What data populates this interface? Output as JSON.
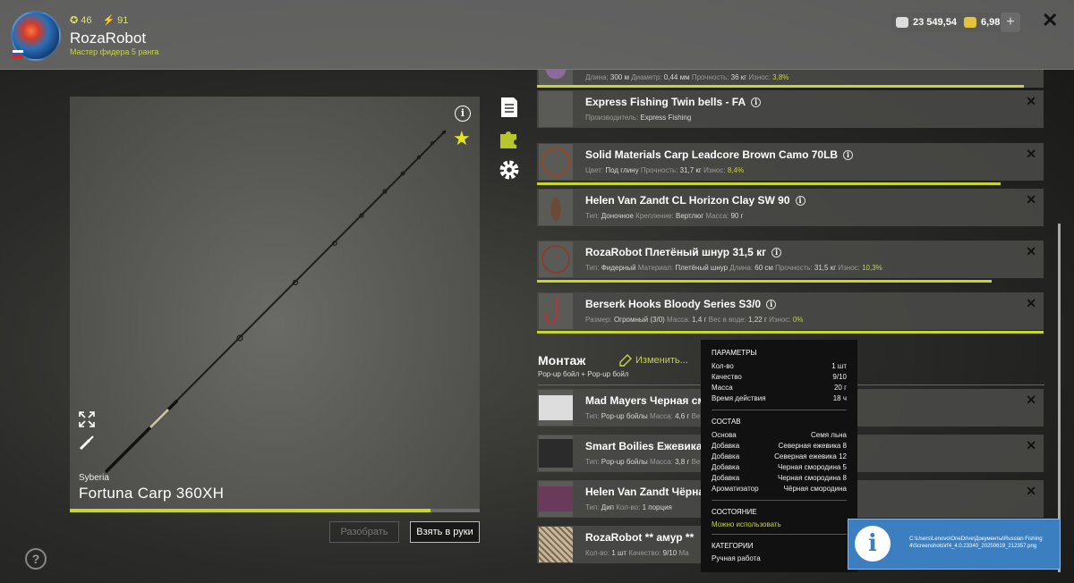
{
  "player": {
    "level": "46",
    "rating": "91",
    "name": "RozaRobot",
    "rank": "Мастер фидера 5 ранга"
  },
  "currency": {
    "silver": "23 549,54",
    "gold": "6,98",
    "add_label": "+"
  },
  "rod": {
    "brand": "Syberia",
    "name": "Fortuna Carp 360XH",
    "wear_fraction": 0.88,
    "disassemble_label": "Разобрать",
    "take_label": "Взять в руки"
  },
  "tackle": [
    {
      "name": "",
      "props": [
        {
          "k": "Длина:",
          "v": "300 м"
        },
        {
          "k": "Диаметр:",
          "v": "0,44 мм"
        },
        {
          "k": "Прочность:",
          "v": "36 кг"
        },
        {
          "k": "Износ:",
          "v": "3,8%",
          "wear": true
        }
      ]
    },
    {
      "name": "Express Fishing Twin bells - FA",
      "props": [
        {
          "k": "Производитель:",
          "v": "Express Fishing"
        }
      ]
    },
    {
      "name": "Solid Materials Carp Leadcore Brown Camo 70LB",
      "props": [
        {
          "k": "Цвет:",
          "v": "Под глину"
        },
        {
          "k": "Прочность:",
          "v": "31,7 кг"
        },
        {
          "k": "Износ:",
          "v": "8,4%",
          "wear": true
        }
      ]
    },
    {
      "name": "Helen Van Zandt CL Horizon Clay SW 90",
      "props": [
        {
          "k": "Тип:",
          "v": "Доночное"
        },
        {
          "k": "Крепление:",
          "v": "Вертлюг"
        },
        {
          "k": "Масса:",
          "v": "90 г"
        }
      ]
    },
    {
      "name": "RozaRobot Плетёный шнур 31,5 кг",
      "props": [
        {
          "k": "Тип:",
          "v": "Фидерный"
        },
        {
          "k": "Материал:",
          "v": "Плетёный шнур"
        },
        {
          "k": "Длина:",
          "v": "60 см"
        },
        {
          "k": "Прочность:",
          "v": "31,5 кг"
        },
        {
          "k": "Износ:",
          "v": "10,3%",
          "wear": true
        }
      ]
    },
    {
      "name": "Berserk Hooks Bloody Series S3/0",
      "props": [
        {
          "k": "Размер:",
          "v": "Огромный (3/0)"
        },
        {
          "k": "Масса:",
          "v": "1,4 г"
        },
        {
          "k": "Вес в воде:",
          "v": "1,22 г"
        },
        {
          "k": "Износ:",
          "v": "0%",
          "wear": true
        }
      ]
    }
  ],
  "montage": {
    "title": "Монтаж",
    "edit_label": "Изменить...",
    "subtitle": "Pop-up бойл  +  Pop-up бойл",
    "items": [
      {
        "name": "Mad Mayers Черная смо",
        "props": [
          {
            "k": "Тип:",
            "v": "Pop-up бойлы"
          },
          {
            "k": "Масса:",
            "v": "4,6 г"
          },
          {
            "k": "Ве",
            "v": ""
          }
        ]
      },
      {
        "name": "Smart Boilies Ежевика Р",
        "props": [
          {
            "k": "Тип:",
            "v": "Pop-up бойлы"
          },
          {
            "k": "Масса:",
            "v": "3,8 г"
          },
          {
            "k": "Ве",
            "v": ""
          }
        ]
      },
      {
        "name": "Helen Van Zandt Чёрная",
        "props": [
          {
            "k": "Тип:",
            "v": "Дип"
          },
          {
            "k": "Кол-во:",
            "v": "1 порция"
          }
        ]
      },
      {
        "name": "RozaRobot ** амур **",
        "props": [
          {
            "k": "Кол-во:",
            "v": "1 шт"
          },
          {
            "k": "Качество:",
            "v": "9/10"
          },
          {
            "k": "Ма",
            "v": ""
          }
        ]
      }
    ]
  },
  "tooltip": {
    "params_title": "ПАРАМЕТРЫ",
    "params": [
      {
        "k": "Кол-во",
        "v": "1 шт"
      },
      {
        "k": "Качество",
        "v": "9/10"
      },
      {
        "k": "Масса",
        "v": "20 г"
      },
      {
        "k": "Время действия",
        "v": "18 ч"
      }
    ],
    "composition_title": "СОСТАВ",
    "composition": [
      {
        "k": "Основа",
        "v": "Семя льна"
      },
      {
        "k": "Добавка",
        "v": "Северная ежевика 8"
      },
      {
        "k": "Добавка",
        "v": "Северная ежевика 12"
      },
      {
        "k": "Добавка",
        "v": "Черная смородина 5"
      },
      {
        "k": "Добавка",
        "v": "Черная смородина 8"
      },
      {
        "k": "Ароматизатор",
        "v": "Чёрная смородина"
      }
    ],
    "state_title": "СОСТОЯНИЕ",
    "state": "Можно использовать",
    "categories_title": "КАТЕГОРИИ",
    "category": "Ручная работа"
  },
  "toast": {
    "icon": "i",
    "message": "C:\\Users\\Lenovo\\OneDrive\\Документы\\Russian Fishing 4\\Screenshots\\rf4_4.0.23340_20250619_212357.png"
  },
  "help_label": "?",
  "colors": {
    "accent": "#c7d62a",
    "topbar": "#969696",
    "toast": "#3b7fc0"
  }
}
